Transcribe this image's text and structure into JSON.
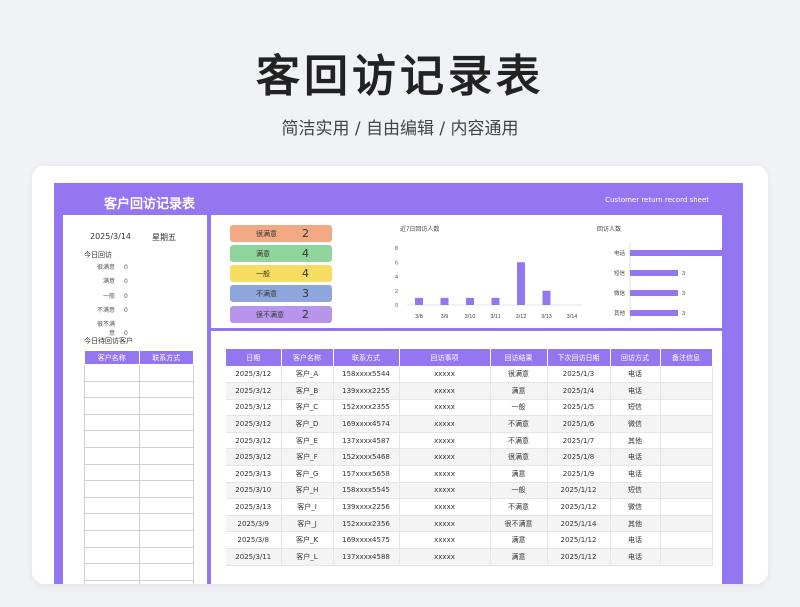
{
  "page": {
    "title": "客回访记录表",
    "subtitle": "简洁实用 / 自由编辑 / 内容通用"
  },
  "banner": {
    "title": "客户回访记录表",
    "subtitle_en": "Customer return record sheet"
  },
  "left": {
    "date": "2025/3/14",
    "weekday": "星期五",
    "today_label": "今日回访",
    "stats": [
      {
        "label": "很满意",
        "value": "0"
      },
      {
        "label": "满意",
        "value": "0"
      },
      {
        "label": "一般",
        "value": "0"
      },
      {
        "label": "不满意",
        "value": "0"
      },
      {
        "label": "很不满意",
        "value": "0"
      }
    ],
    "pending_label": "今日待回访客户",
    "pending_headers": [
      "客户名称",
      "联系方式"
    ]
  },
  "satisfaction": [
    {
      "label": "很满意",
      "count": "2",
      "color": "#f2a983"
    },
    {
      "label": "满意",
      "count": "4",
      "color": "#8fd49a"
    },
    {
      "label": "一般",
      "count": "4",
      "color": "#f6dd62"
    },
    {
      "label": "不满意",
      "count": "3",
      "color": "#8fa6dc"
    },
    {
      "label": "很不满意",
      "count": "2",
      "color": "#b795ea"
    }
  ],
  "chart_data": [
    {
      "type": "bar",
      "title": "近7日回访人数",
      "categories": [
        "3/8",
        "3/9",
        "3/10",
        "3/11",
        "3/12",
        "3/13",
        "3/14"
      ],
      "values": [
        1,
        1,
        1,
        1,
        6,
        2,
        0
      ],
      "yticks": [
        "0",
        "2",
        "4",
        "6",
        "8"
      ],
      "ylim": [
        0,
        8
      ],
      "color": "#9477f0"
    },
    {
      "type": "bar",
      "orientation": "horizontal",
      "title": "回访人数",
      "categories": [
        "电话",
        "短信",
        "微信",
        "其他"
      ],
      "values": [
        6,
        3,
        3,
        3
      ],
      "color": "#9477f0"
    }
  ],
  "table": {
    "headers": [
      "日期",
      "客户名称",
      "联系方式",
      "回访事项",
      "回访结果",
      "下次回访日期",
      "回访方式",
      "备注信息"
    ],
    "rows": [
      [
        "2025/3/12",
        "客户_A",
        "158xxxx5544",
        "xxxxx",
        "很满意",
        "2025/1/3",
        "电话",
        ""
      ],
      [
        "2025/3/12",
        "客户_B",
        "139xxxx2255",
        "xxxxx",
        "满意",
        "2025/1/4",
        "电话",
        ""
      ],
      [
        "2025/3/12",
        "客户_C",
        "152xxxx2355",
        "xxxxx",
        "一般",
        "2025/1/5",
        "短信",
        ""
      ],
      [
        "2025/3/12",
        "客户_D",
        "169xxxx4574",
        "xxxxx",
        "不满意",
        "2025/1/6",
        "微信",
        ""
      ],
      [
        "2025/3/12",
        "客户_E",
        "137xxxx4587",
        "xxxxx",
        "不满意",
        "2025/1/7",
        "其他",
        ""
      ],
      [
        "2025/3/12",
        "客户_F",
        "152xxxx5468",
        "xxxxx",
        "很满意",
        "2025/1/8",
        "电话",
        ""
      ],
      [
        "2025/3/13",
        "客户_G",
        "157xxxx5658",
        "xxxxx",
        "满意",
        "2025/1/9",
        "电话",
        ""
      ],
      [
        "2025/3/10",
        "客户_H",
        "158xxxx5545",
        "xxxxx",
        "一般",
        "2025/1/12",
        "短信",
        ""
      ],
      [
        "2025/3/13",
        "客户_I",
        "139xxxx2256",
        "xxxxx",
        "不满意",
        "2025/1/12",
        "微信",
        ""
      ],
      [
        "2025/3/9",
        "客户_J",
        "152xxxx2356",
        "xxxxx",
        "很不满意",
        "2025/1/14",
        "其他",
        ""
      ],
      [
        "2025/3/8",
        "客户_K",
        "169xxxx4575",
        "xxxxx",
        "满意",
        "2025/1/12",
        "电话",
        ""
      ],
      [
        "2025/3/11",
        "客户_L",
        "137xxxx4588",
        "xxxxx",
        "满意",
        "2025/1/12",
        "电话",
        ""
      ]
    ]
  }
}
